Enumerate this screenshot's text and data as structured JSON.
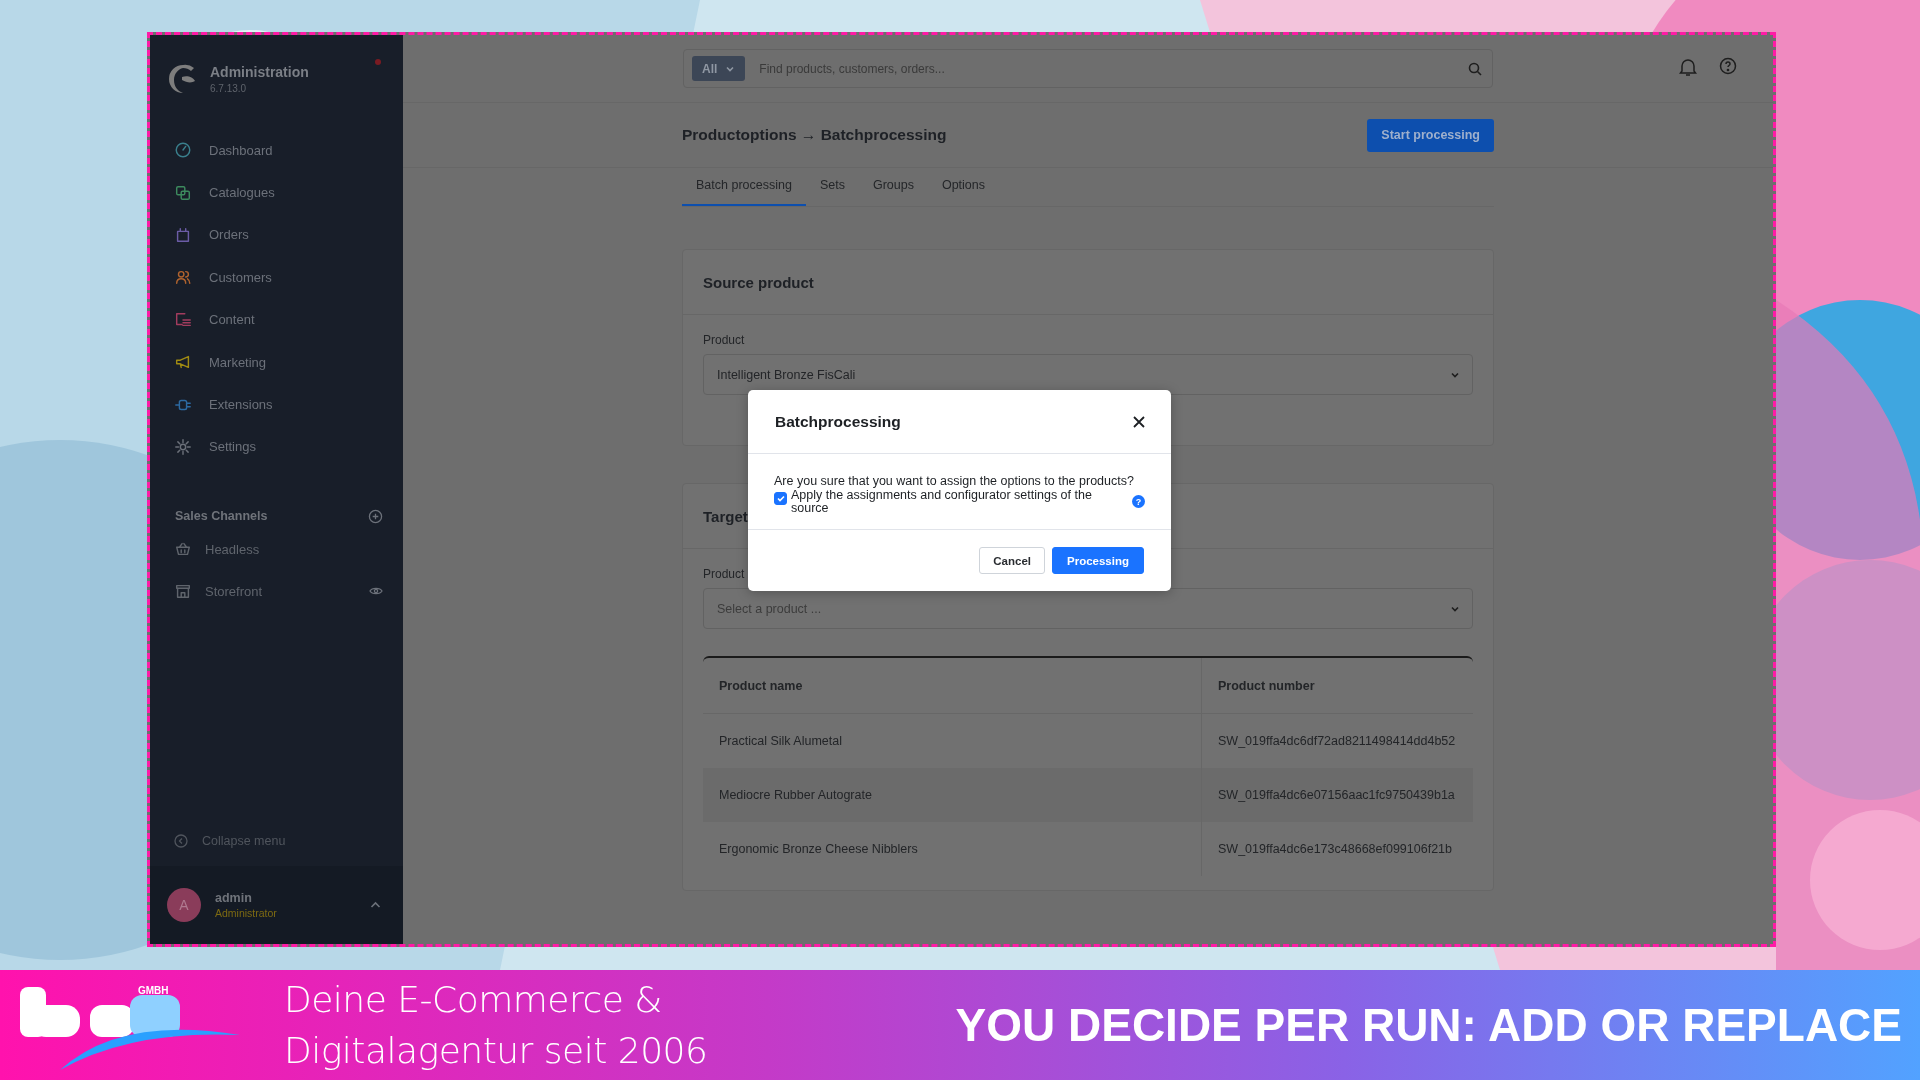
{
  "sidebar": {
    "title": "Administration",
    "version": "6.7.13.0",
    "notification": true,
    "nav": [
      {
        "label": "Dashboard",
        "kind": "dashboard",
        "color": "#3a7f8c"
      },
      {
        "label": "Catalogues",
        "kind": "catalogues",
        "color": "#3d8a5e"
      },
      {
        "label": "Orders",
        "kind": "orders",
        "color": "#6b5ca6"
      },
      {
        "label": "Customers",
        "kind": "customers",
        "color": "#b0632e"
      },
      {
        "label": "Content",
        "kind": "content",
        "color": "#a23c5e"
      },
      {
        "label": "Marketing",
        "kind": "marketing",
        "color": "#a08b12"
      },
      {
        "label": "Extensions",
        "kind": "extensions",
        "color": "#2c6aa2"
      },
      {
        "label": "Settings",
        "kind": "settings",
        "color": "#6b7079"
      }
    ],
    "sales_channels": {
      "heading": "Sales Channels",
      "items": [
        {
          "label": "Headless",
          "kind": "basket"
        },
        {
          "label": "Storefront",
          "kind": "store"
        }
      ]
    },
    "collapse": "Collapse menu",
    "user": {
      "initial": "A",
      "name": "admin",
      "role": "Administrator"
    }
  },
  "search": {
    "scope": "All",
    "placeholder": "Find products, customers, orders..."
  },
  "page": {
    "title": "Productoptions → Batchprocessing",
    "action": "Start processing"
  },
  "tabs": [
    {
      "label": "Batch processing",
      "selected": true
    },
    {
      "label": "Sets",
      "selected": false
    },
    {
      "label": "Groups",
      "selected": false
    },
    {
      "label": "Options",
      "selected": false
    }
  ],
  "source_card": {
    "title": "Source product",
    "field_label": "Product",
    "value": "Intelligent Bronze FisCali"
  },
  "target_card": {
    "title": "Target",
    "field_label": "Product",
    "placeholder": "Select a product ...",
    "table": {
      "columns": [
        "Product name",
        "Product number"
      ],
      "rows": [
        [
          "Practical Silk Alumetal",
          "SW_019ffa4dc6df72ad8211498414dd4b52"
        ],
        [
          "Mediocre Rubber Autograte",
          "SW_019ffa4dc6e07156aac1fc9750439b1a"
        ],
        [
          "Ergonomic Bronze Cheese Nibblers",
          "SW_019ffa4dc6e173c48668ef099106f21b"
        ]
      ]
    }
  },
  "modal": {
    "title": "Batchprocessing",
    "message": "Are you sure that you want to assign the options to the products?",
    "checkbox": {
      "label": "Apply the assignments and configurator settings of the source",
      "checked": true
    },
    "help": "?",
    "buttons": [
      {
        "label": "Cancel",
        "kind": "secondary"
      },
      {
        "label": "Processing",
        "kind": "primary"
      }
    ]
  },
  "banner": {
    "logo_badge": "GMBH",
    "tagline": "Deine E-Commerce & Digitalagentur seit 2006",
    "headline": "YOU DECIDE PER RUN: ADD OR REPLACE"
  }
}
